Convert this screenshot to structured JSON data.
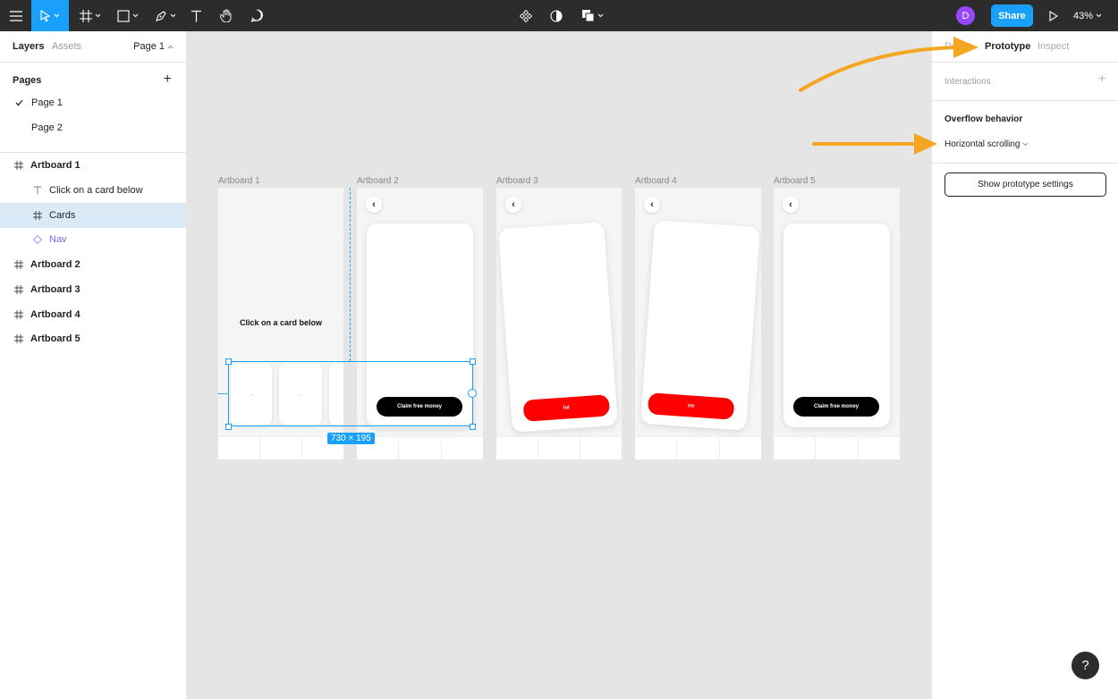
{
  "toolbar": {
    "avatar_initial": "D",
    "share_label": "Share",
    "zoom": "43%"
  },
  "left_panel": {
    "tabs": [
      "Layers",
      "Assets"
    ],
    "page_selector": "Page 1",
    "pages_title": "Pages",
    "pages": [
      "Page 1",
      "Page 2"
    ],
    "layers": [
      {
        "label": "Artboard 1",
        "icon": "frame"
      },
      {
        "label": "Click on a card below",
        "icon": "text"
      },
      {
        "label": "Cards",
        "icon": "frame"
      },
      {
        "label": "Nav",
        "icon": "component"
      },
      {
        "label": "Artboard 2",
        "icon": "frame"
      },
      {
        "label": "Artboard 3",
        "icon": "frame"
      },
      {
        "label": "Artboard 4",
        "icon": "frame"
      },
      {
        "label": "Artboard 5",
        "icon": "frame"
      }
    ]
  },
  "canvas": {
    "artboards": [
      "Artboard 1",
      "Artboard 2",
      "Artboard 3",
      "Artboard 4",
      "Artboard 5"
    ],
    "ab1_heading": "Click on a card below",
    "claim_label": "Claim free money",
    "lol_label": "lol",
    "no_label": "no",
    "selection_size": "730 × 195",
    "small_card_dot": "·"
  },
  "right_panel": {
    "tabs": [
      "Design",
      "Prototype",
      "Inspect"
    ],
    "interactions_label": "Interactions",
    "overflow_title": "Overflow behavior",
    "overflow_value": "Horizontal scrolling",
    "settings_button": "Show prototype settings"
  },
  "help_label": "?",
  "colors": {
    "accent": "#18a0fb",
    "toolbar_bg": "#2c2c2c",
    "avatar": "#9747ff",
    "annotation_arrow": "#f5a623",
    "red_pill": "#ff0000"
  }
}
